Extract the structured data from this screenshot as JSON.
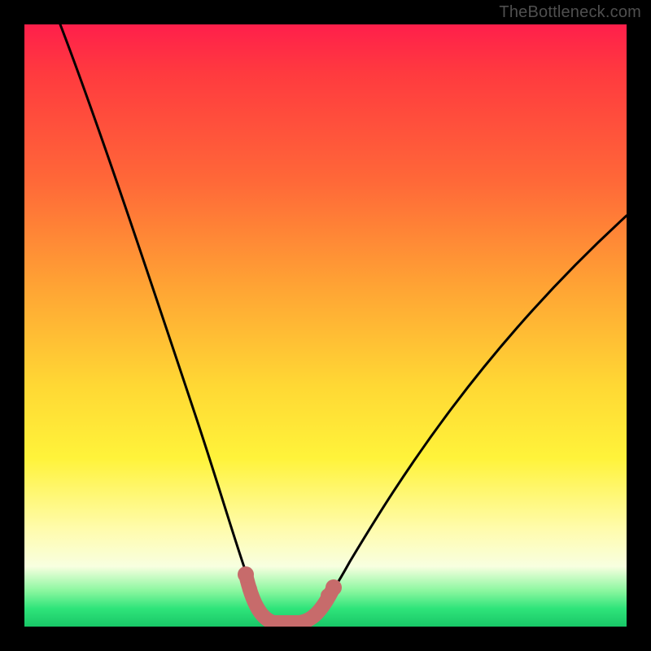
{
  "watermark": {
    "text": "TheBottleneck.com"
  },
  "chart_data": {
    "type": "line",
    "title": "",
    "xlabel": "",
    "ylabel": "",
    "xlim": [
      0,
      100
    ],
    "ylim": [
      0,
      100
    ],
    "grid": false,
    "legend": false,
    "series": [
      {
        "name": "bottleneck-curve",
        "x": [
          6,
          10,
          15,
          20,
          25,
          30,
          33,
          36,
          38,
          40,
          42,
          44,
          46,
          48,
          52,
          58,
          64,
          70,
          76,
          82,
          88,
          94,
          100
        ],
        "y": [
          100,
          86,
          70,
          55,
          40,
          26,
          16,
          8,
          3,
          1,
          0,
          0,
          0,
          1,
          4,
          10,
          18,
          26,
          34,
          43,
          52,
          60,
          68
        ]
      },
      {
        "name": "highlight-band",
        "x": [
          36,
          38,
          40,
          42,
          44,
          46,
          48
        ],
        "y": [
          8,
          3,
          1,
          0,
          0,
          1,
          4
        ]
      }
    ],
    "colors": {
      "curve": "#000000",
      "highlight": "#c76b6b",
      "gradient_top": "#ff1f4b",
      "gradient_mid": "#ffe03a",
      "gradient_bottom": "#18c767"
    }
  }
}
